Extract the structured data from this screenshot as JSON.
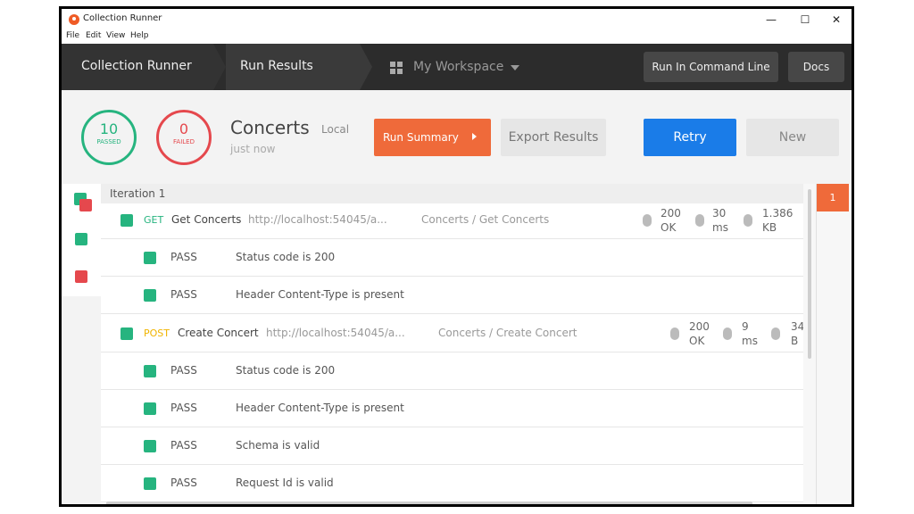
{
  "window": {
    "title": "Collection Runner",
    "controls": {
      "minimize": "—",
      "maximize": "☐",
      "close": "✕"
    }
  },
  "menu": [
    "File",
    "Edit",
    "View",
    "Help"
  ],
  "nav": {
    "runner": "Collection Runner",
    "results": "Run Results",
    "workspace": "My Workspace",
    "command_line": "Run In Command Line",
    "docs": "Docs"
  },
  "summary": {
    "passed": {
      "count": "10",
      "label": "PASSED"
    },
    "failed": {
      "count": "0",
      "label": "FAILED"
    },
    "collection": "Concerts",
    "environment": "Local",
    "time": "just now",
    "run_summary": "Run Summary",
    "export": "Export Results",
    "retry": "Retry",
    "new": "New"
  },
  "iteration": {
    "label": "Iteration 1",
    "tab": "1"
  },
  "requests": [
    {
      "method": "GET",
      "name": "Get Concerts",
      "url": "http://localhost:54045/a...",
      "path": "Concerts / Get Concerts",
      "status": "200",
      "status_text": "OK",
      "time": "30",
      "time_unit": "ms",
      "size": "1.386",
      "size_unit": "KB",
      "tests": [
        {
          "result": "PASS",
          "name": "Status code is 200"
        },
        {
          "result": "PASS",
          "name": "Header Content-Type is present"
        }
      ]
    },
    {
      "method": "POST",
      "name": "Create Concert",
      "url": "http://localhost:54045/a...",
      "path": "Concerts / Create Concert",
      "status": "200",
      "status_text": "OK",
      "time": "9",
      "time_unit": "ms",
      "size": "34",
      "size_unit": "B",
      "tests": [
        {
          "result": "PASS",
          "name": "Status code is 200"
        },
        {
          "result": "PASS",
          "name": "Header Content-Type is present"
        },
        {
          "result": "PASS",
          "name": "Schema is valid"
        },
        {
          "result": "PASS",
          "name": "Request Id is valid"
        }
      ]
    }
  ],
  "colors": {
    "pass": "#26b47f",
    "fail": "#e5484d",
    "accent_orange": "#ef6a3a",
    "accent_blue": "#1a7ce8",
    "nav_bg": "#2c2c2c"
  }
}
